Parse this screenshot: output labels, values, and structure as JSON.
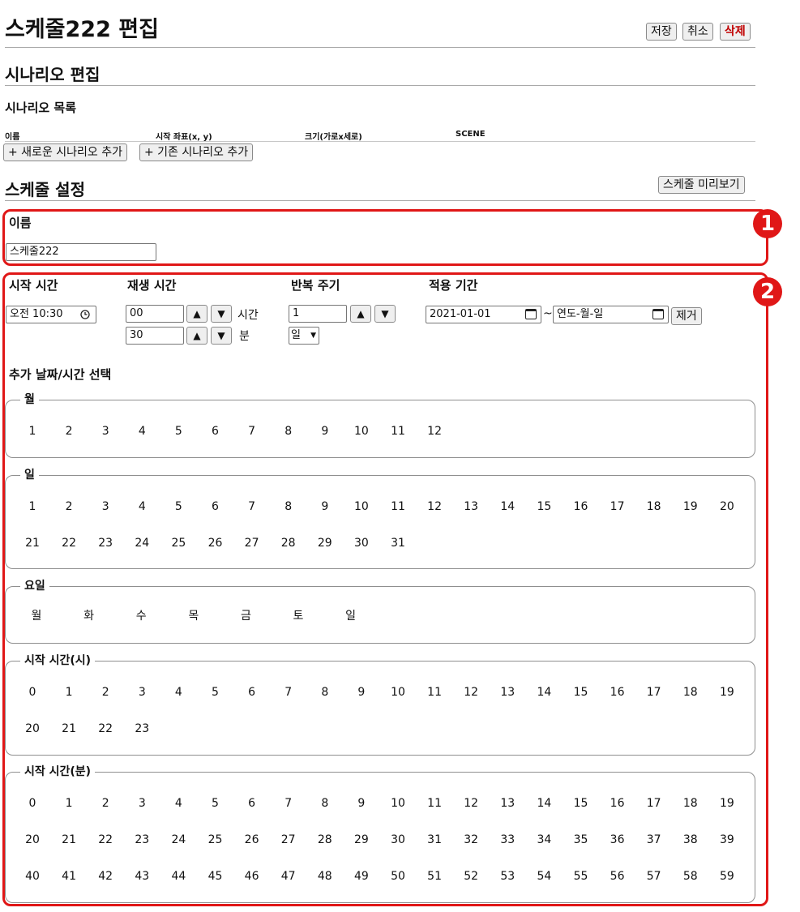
{
  "page": {
    "title": "스케줄222 편집",
    "save_label": "저장",
    "cancel_label": "취소",
    "delete_label": "삭제"
  },
  "scenario": {
    "heading": "시나리오 편집",
    "list_heading": "시나리오 목록",
    "columns": [
      "이름",
      "시작 좌표(x, y)",
      "크기(가로x세로)",
      "SCENE"
    ],
    "add_new_label": "+ 새로운 시나리오 추가",
    "add_existing_label": "+ 기존 시나리오 추가"
  },
  "schedule": {
    "heading": "스케줄 설정",
    "preview_label": "스케줄 미리보기",
    "name_label": "이름",
    "name_value": "스케줄222",
    "start_time_label": "시작 시간",
    "start_time_value": "오전 10:30",
    "play_time_label": "재생 시간",
    "play_hours": "00",
    "hours_unit": "시간",
    "play_minutes": "30",
    "minutes_unit": "분",
    "repeat_label": "반복 주기",
    "repeat_value": "1",
    "repeat_unit": "일",
    "period_label": "적용 기간",
    "period_start": "2021-01-01",
    "period_sep": "~",
    "period_end_placeholder": "연도-월-일",
    "remove_label": "제거",
    "extra_heading": "추가 날짜/시간 선택",
    "spin_up": "▲",
    "spin_down": "▼"
  },
  "groups": {
    "month": {
      "legend": "월",
      "rows": [
        [
          "1",
          "2",
          "3",
          "4",
          "5",
          "6",
          "7",
          "8",
          "9",
          "10",
          "11",
          "12"
        ]
      ]
    },
    "day": {
      "legend": "일",
      "rows": [
        [
          "1",
          "2",
          "3",
          "4",
          "5",
          "6",
          "7",
          "8",
          "9",
          "10",
          "11",
          "12",
          "13",
          "14",
          "15",
          "16",
          "17",
          "18",
          "19",
          "20"
        ],
        [
          "21",
          "22",
          "23",
          "24",
          "25",
          "26",
          "27",
          "28",
          "29",
          "30",
          "31"
        ]
      ]
    },
    "weekday": {
      "legend": "요일",
      "rows": [
        [
          "월",
          "화",
          "수",
          "목",
          "금",
          "토",
          "일"
        ]
      ]
    },
    "hour": {
      "legend": "시작 시간(시)",
      "rows": [
        [
          "0",
          "1",
          "2",
          "3",
          "4",
          "5",
          "6",
          "7",
          "8",
          "9",
          "10",
          "11",
          "12",
          "13",
          "14",
          "15",
          "16",
          "17",
          "18",
          "19"
        ],
        [
          "20",
          "21",
          "22",
          "23"
        ]
      ]
    },
    "minute": {
      "legend": "시작 시간(분)",
      "rows": [
        [
          "0",
          "1",
          "2",
          "3",
          "4",
          "5",
          "6",
          "7",
          "8",
          "9",
          "10",
          "11",
          "12",
          "13",
          "14",
          "15",
          "16",
          "17",
          "18",
          "19"
        ],
        [
          "20",
          "21",
          "22",
          "23",
          "24",
          "25",
          "26",
          "27",
          "28",
          "29",
          "30",
          "31",
          "32",
          "33",
          "34",
          "35",
          "36",
          "37",
          "38",
          "39"
        ],
        [
          "40",
          "41",
          "42",
          "43",
          "44",
          "45",
          "46",
          "47",
          "48",
          "49",
          "50",
          "51",
          "52",
          "53",
          "54",
          "55",
          "56",
          "57",
          "58",
          "59"
        ]
      ]
    }
  },
  "annotations": {
    "badge1": "1",
    "badge2": "2",
    "accent_color": "#e01717",
    "delete_color": "#c00000"
  }
}
